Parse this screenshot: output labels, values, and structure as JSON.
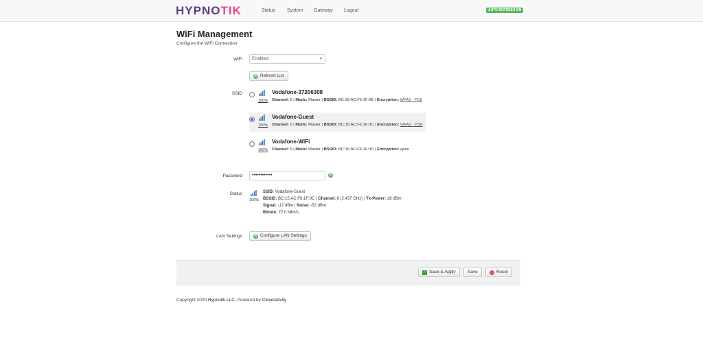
{
  "header": {
    "logo": {
      "part1": "HYPNO",
      "part2": "TIK"
    },
    "nav": [
      {
        "label": "Status"
      },
      {
        "label": "System"
      },
      {
        "label": "Gateway"
      },
      {
        "label": "Logout"
      }
    ],
    "auto_refresh_badge": "AUTO REFRESH ON",
    "colors": {
      "brand_purple": "#5b3d86",
      "brand_pink": "#e8488b",
      "badge_green": "#5cb85c"
    }
  },
  "page": {
    "title": "WiFi Management",
    "description": "Configure the WiFi Connection."
  },
  "wifi": {
    "label": "WiFi",
    "selected": "Enabled"
  },
  "refresh_button": "Refresh List",
  "ssid_section": {
    "label": "SSID",
    "networks": [
      {
        "name": "Vodafone-37206308",
        "signal": "100%",
        "channel_label": "Channel:",
        "channel": "6",
        "mode_label": "Mode:",
        "mode": "Master",
        "bssid_label": "BSSID:",
        "bssid": "BC:15:AC:F6:1F:0B",
        "enc_label": "Encryption:",
        "encryption": "WPA2 - PSK",
        "selected": false
      },
      {
        "name": "Vodafone-Guest",
        "signal": "100%",
        "channel_label": "Channel:",
        "channel": "6",
        "mode_label": "Mode:",
        "mode": "Master",
        "bssid_label": "BSSID:",
        "bssid": "BC:15:AC:F6:1F:0C",
        "enc_label": "Encryption:",
        "encryption": "WPA2 - PSK",
        "selected": true
      },
      {
        "name": "Vodafone-WiFi",
        "signal": "100%",
        "channel_label": "Channel:",
        "channel": "6",
        "mode_label": "Mode:",
        "mode": "Master",
        "bssid_label": "BSSID:",
        "bssid": "BC:15:AC:F6:1F:0D",
        "enc_label": "Encryption:",
        "encryption": "open",
        "selected": false
      }
    ]
  },
  "password": {
    "label": "Password",
    "value": "••••••••••••"
  },
  "status": {
    "label": "Status",
    "signal": "100%",
    "ssid_label": "SSID:",
    "ssid": "Vodafone-Guest",
    "bssid_label": "BSSID:",
    "bssid": "BC:15:AC:F6:1F:0C",
    "channel_label": "Channel:",
    "channel": "6 (2.437 GHz)",
    "txpower_label": "Tx-Power:",
    "txpower": "18 dBm",
    "signal_label": "Signal:",
    "signal_value": "-17 dBm",
    "noise_label": "Noise:",
    "noise": "-52 dBm",
    "bitrate_label": "Bitrate:",
    "bitrate": "72.0 Mbit/s"
  },
  "lan": {
    "label": "LAN Settings",
    "button": "Configure LAN Settings"
  },
  "actions": {
    "save_apply": "Save & Apply",
    "save": "Save",
    "reset": "Reset"
  },
  "footer": {
    "prefix": "Copyright 2020",
    "company": "Hypnotik LLC",
    "middle": ", Powered by",
    "powered": "Cleverativity"
  }
}
